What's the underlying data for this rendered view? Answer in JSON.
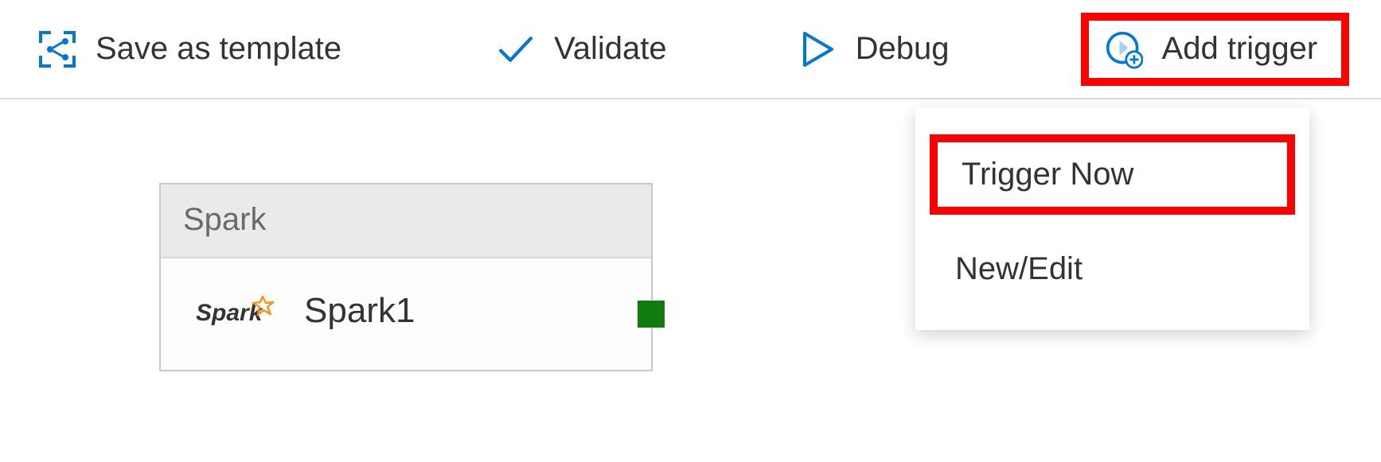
{
  "toolbar": {
    "save_as_template": "Save as template",
    "validate": "Validate",
    "debug": "Debug",
    "add_trigger": "Add trigger"
  },
  "dropdown": {
    "trigger_now": "Trigger Now",
    "new_edit": "New/Edit"
  },
  "activity": {
    "type": "Spark",
    "name": "Spark1"
  },
  "colors": {
    "icon_blue": "#0078d4",
    "highlight_red": "#ff0000",
    "connector_green": "#107c10",
    "spark_orange": "#f7941d"
  }
}
